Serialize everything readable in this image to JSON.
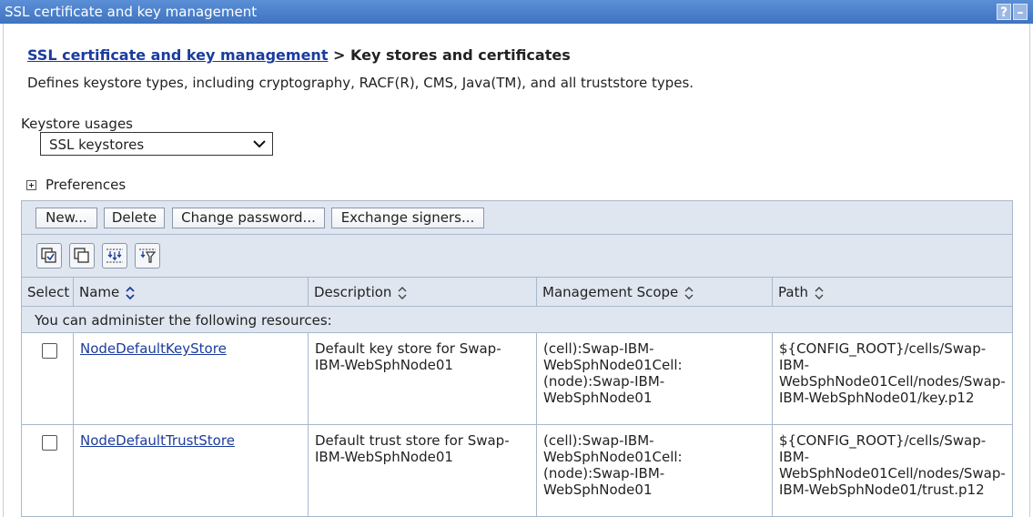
{
  "window": {
    "title": "SSL certificate and key management",
    "help_glyph": "?",
    "minimize_glyph": "–"
  },
  "breadcrumb": {
    "link": "SSL certificate and key management",
    "separator": ">",
    "current": "Key stores and certificates"
  },
  "description": "Defines keystore types, including cryptography, RACF(R), CMS, Java(TM), and all truststore types.",
  "keystore_usages": {
    "label": "Keystore usages",
    "selected": "SSL keystores"
  },
  "preferences": {
    "label": "Preferences"
  },
  "toolbar": {
    "buttons": [
      "New...",
      "Delete",
      "Change password...",
      "Exchange signers..."
    ],
    "icons": [
      "select-all-icon",
      "deselect-all-icon",
      "show-filter-icon",
      "clear-filter-icon"
    ]
  },
  "table": {
    "columns": [
      "Select",
      "Name",
      "Description",
      "Management Scope",
      "Path"
    ],
    "notice": "You can administer the following resources:",
    "rows": [
      {
        "name": "NodeDefaultKeyStore",
        "description": [
          "Default key store for Swap-",
          "IBM-WebSphNode01"
        ],
        "scope": [
          "(cell):Swap-IBM-",
          "WebSphNode01Cell:",
          "(node):Swap-IBM-",
          "WebSphNode01"
        ],
        "path": [
          "${CONFIG_ROOT}/cells/Swap-",
          "IBM-",
          "WebSphNode01Cell/nodes/Swap-",
          "IBM-WebSphNode01/key.p12"
        ],
        "selected": false
      },
      {
        "name": "NodeDefaultTrustStore",
        "description": [
          "Default trust store for Swap-",
          "IBM-WebSphNode01"
        ],
        "scope": [
          "(cell):Swap-IBM-",
          "WebSphNode01Cell:",
          "(node):Swap-IBM-",
          "WebSphNode01"
        ],
        "path": [
          "${CONFIG_ROOT}/cells/Swap-",
          "IBM-",
          "WebSphNode01Cell/nodes/Swap-",
          "IBM-WebSphNode01/trust.p12"
        ],
        "selected": false
      }
    ]
  }
}
